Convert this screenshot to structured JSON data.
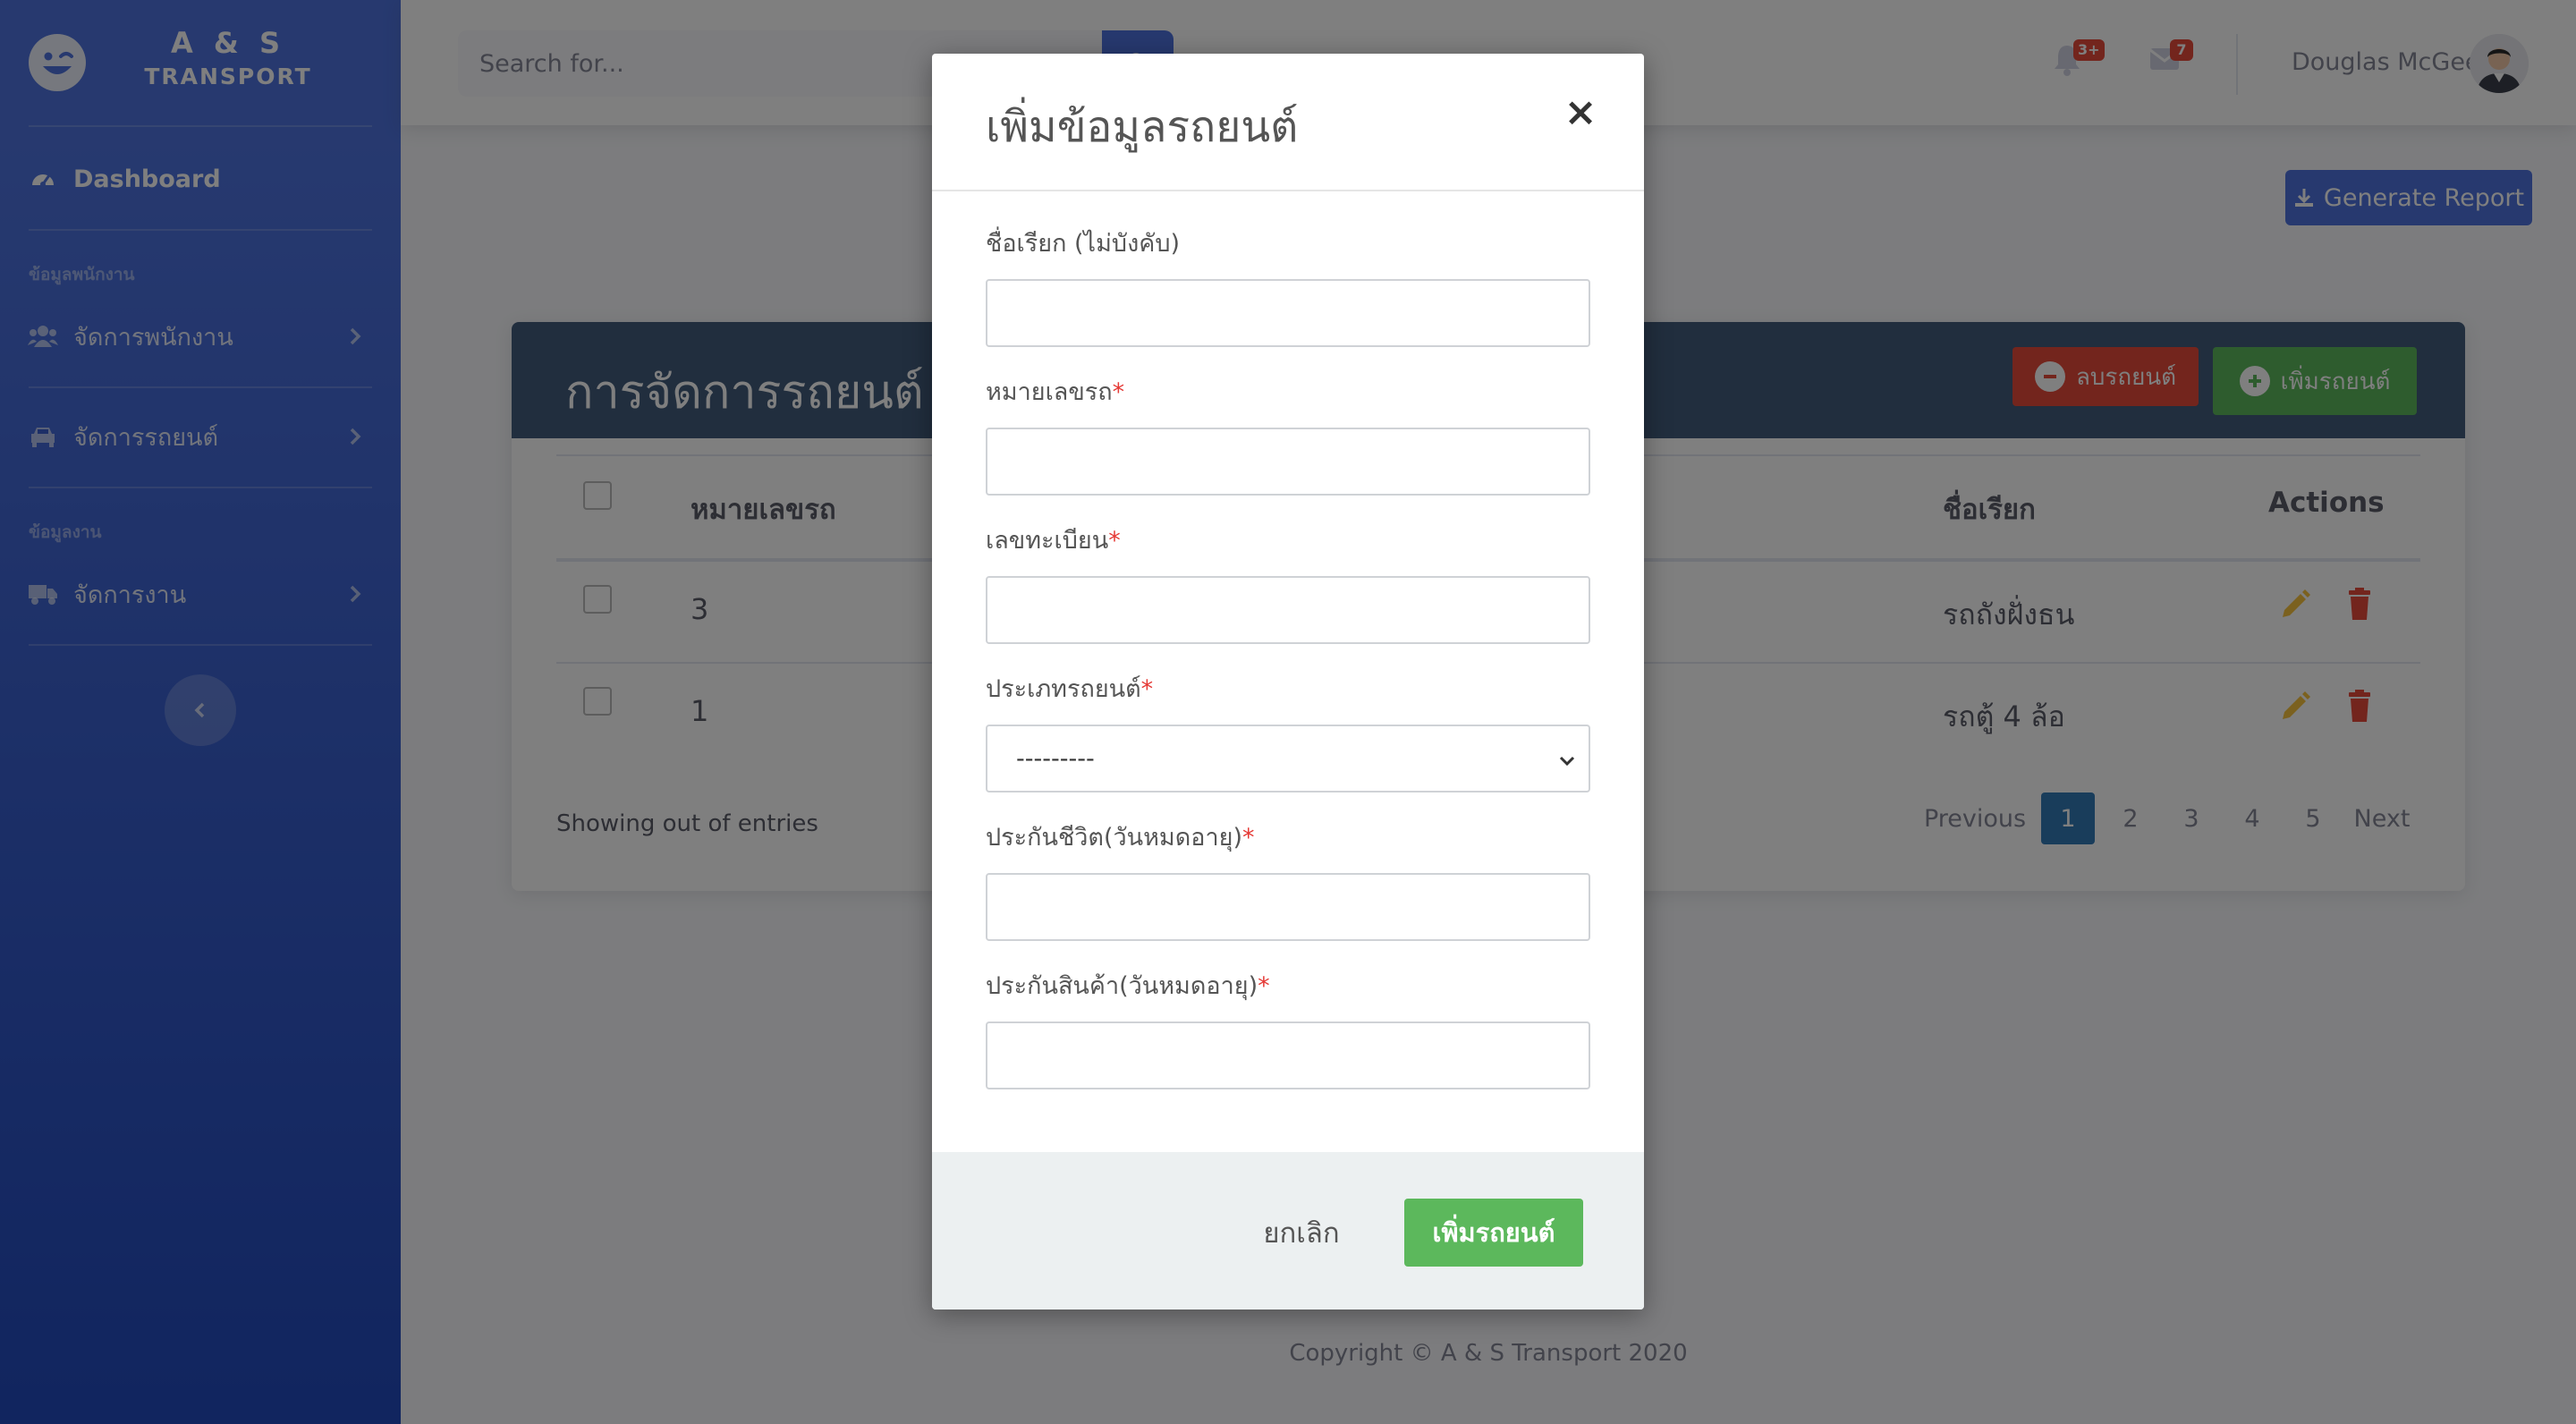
{
  "app": {
    "brand_line1": "A & S",
    "brand_line2": "TRANSPORT",
    "accent_color": "#4e73df",
    "brand_icon": "laugh-wink-icon"
  },
  "sidebar": {
    "dashboard_label": "Dashboard",
    "heading_employee": "ข้อมูลพนักงาน",
    "heading_work": "ข้อมูลงาน",
    "items": [
      {
        "label": "จัดการพนักงาน",
        "icon": "users-icon"
      },
      {
        "label": "จัดการรถยนต์",
        "icon": "car-icon"
      },
      {
        "label": "จัดการงาน",
        "icon": "truck-icon"
      }
    ],
    "toggle_icon": "chevron-left-icon"
  },
  "topbar": {
    "search_placeholder": "Search for...",
    "alerts_count": "3+",
    "messages_count": "7",
    "user_name": "Douglas McGee"
  },
  "content": {
    "generate_report_label": "Generate Report",
    "table_title": "การจัดการรถยนต์",
    "delete_button_label": "ลบรถยนต์",
    "add_button_label": "เพิ่มรถยนต์",
    "columns": {
      "number": "หมายเลขรถ",
      "nickname": "ชื่อเรียก",
      "actions": "Actions"
    },
    "rows": [
      {
        "number": "3",
        "nickname": "รถถังฝั่งธน"
      },
      {
        "number": "1",
        "nickname": "รถตู้ 4 ล้อ"
      }
    ],
    "showing_text": "Showing out of entries",
    "pagination": {
      "previous": "Previous",
      "pages": [
        "1",
        "2",
        "3",
        "4",
        "5"
      ],
      "active_page": "1",
      "next": "Next"
    },
    "copyright": "Copyright © A & S Transport 2020"
  },
  "modal": {
    "title": "เพิ่มข้อมูลรถยนต์",
    "close_glyph": "×",
    "fields": {
      "nickname": {
        "label": "ชื่อเรียก (ไม่บังคับ)",
        "value": ""
      },
      "car_number": {
        "label": "หมายเลขรถ",
        "value": ""
      },
      "plate": {
        "label": "เลขทะเบียน",
        "value": ""
      },
      "car_type": {
        "label": "ประเภทรถยนต์",
        "selected": "---------"
      },
      "life_insurance": {
        "label": "ประกันชีวิต(วันหมดอายุ)",
        "value": ""
      },
      "cargo_insurance": {
        "label": "ประกันสินค้า(วันหมดอายุ)",
        "value": ""
      }
    },
    "required_mark": "*",
    "cancel_label": "ยกเลิก",
    "submit_label": "เพิ่มรถยนต์",
    "submit_color": "#5cb85c"
  }
}
